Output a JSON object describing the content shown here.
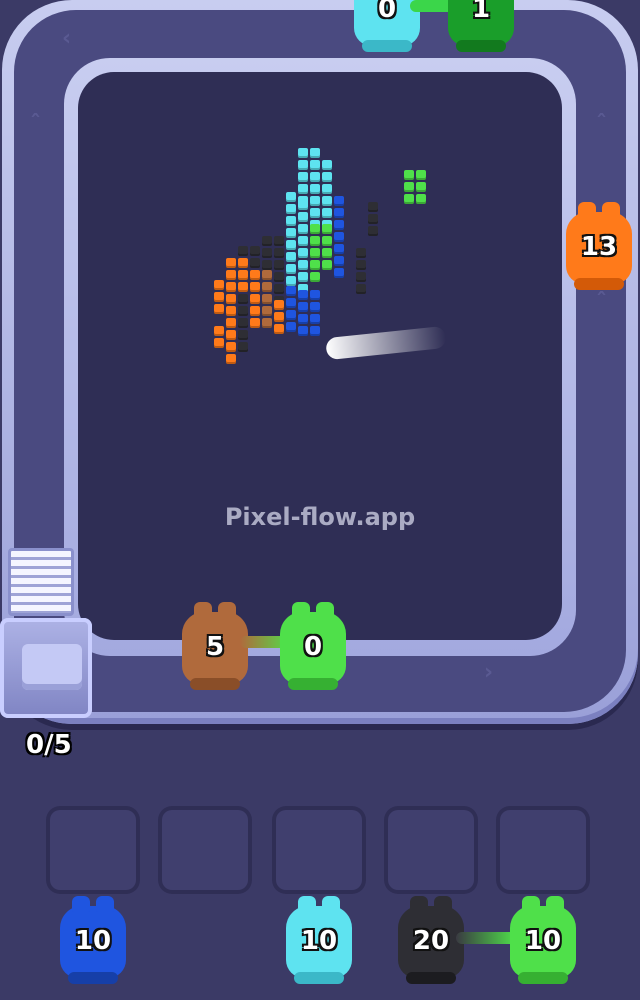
{
  "watermark": "Pixel-flow.app",
  "watermark_faint": "Pixel-Flow.app",
  "counter": "0/5",
  "colors": {
    "orange": "#ff7a1a",
    "brown": "#b06a3c",
    "lime": "#4fe04a",
    "cyan": "#5ee3f0",
    "blue": "#1f55e0",
    "black": "#2e2e34",
    "darkgreen": "#1a9e2a"
  },
  "track_creatures": {
    "top_cyan": {
      "count": "0",
      "color": "cyan"
    },
    "top_green": {
      "count": "1",
      "color": "darkgreen"
    },
    "right_orange": {
      "count": "13",
      "color": "orange"
    },
    "bottom_brown": {
      "count": "5",
      "color": "brown"
    },
    "bottom_lime": {
      "count": "0",
      "color": "lime"
    }
  },
  "queue": [
    {
      "count": "10",
      "color": "blue"
    },
    {
      "count": "10",
      "color": "cyan"
    },
    {
      "count": "20",
      "color": "black"
    },
    {
      "count": "10",
      "color": "lime"
    }
  ]
}
